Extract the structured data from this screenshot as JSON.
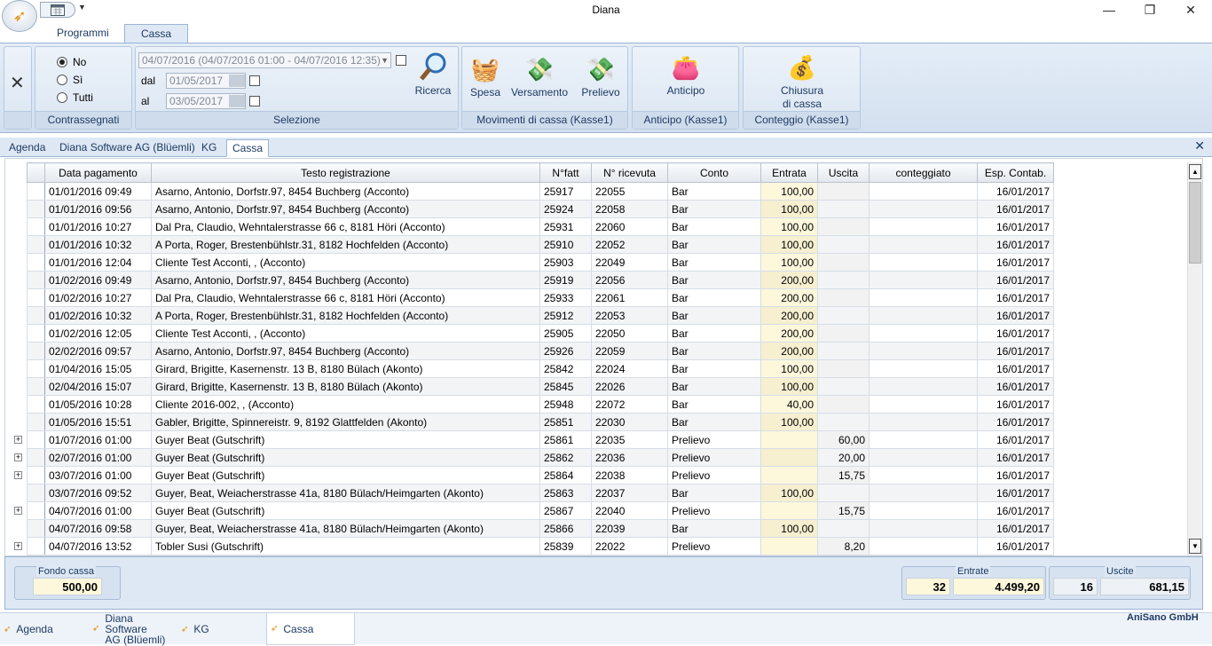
{
  "window": {
    "title": "Diana"
  },
  "ribbon_tabs": [
    "Programmi",
    "Cassa"
  ],
  "ribbon": {
    "contrassegnati": {
      "caption": "Contrassegnati",
      "options": [
        "No",
        "Sì",
        "Tutti"
      ],
      "selected": "No"
    },
    "selezione": {
      "caption": "Selezione",
      "period": "04/07/2016 (04/07/2016 01:00 - 04/07/2016 12:35)",
      "dal_label": "dal",
      "dal_value": "01/05/2017",
      "al_label": "al",
      "al_value": "03/05/2017",
      "search_label": "Ricerca"
    },
    "movimenti": {
      "caption": "Movimenti di cassa (Kasse1)",
      "spesa": "Spesa",
      "versamento": "Versamento",
      "prelievo": "Prelievo"
    },
    "anticipo": {
      "caption": "Anticipo (Kasse1)",
      "label": "Anticipo"
    },
    "conteggio": {
      "caption": "Conteggio (Kasse1)",
      "label1": "Chiusura",
      "label2": "di cassa"
    }
  },
  "doc_tabs": [
    "Agenda",
    "Diana Software AG (Blüemli)",
    "KG",
    "Cassa"
  ],
  "table": {
    "columns": [
      "Data pagamento",
      "Testo registrazione",
      "N°fatt",
      "N° ricevuta",
      "Conto",
      "Entrata",
      "Uscita",
      "conteggiato",
      "Esp. Contab."
    ],
    "rows": [
      {
        "d": "01/01/2016 09:49",
        "t": "Asarno, Antonio, Dorfstr.97, 8454 Buchberg (Acconto)",
        "f": "25917",
        "r": "22055",
        "c": "Bar",
        "e": "100,00",
        "u": "",
        "k": "",
        "x": "16/01/2017"
      },
      {
        "d": "01/01/2016 09:56",
        "t": "Asarno, Antonio, Dorfstr.97, 8454 Buchberg (Acconto)",
        "f": "25924",
        "r": "22058",
        "c": "Bar",
        "e": "100,00",
        "u": "",
        "k": "",
        "x": "16/01/2017"
      },
      {
        "d": "01/01/2016 10:27",
        "t": "Dal Pra, Claudio, Wehntalerstrasse 66 c, 8181 Höri (Acconto)",
        "f": "25931",
        "r": "22060",
        "c": "Bar",
        "e": "100,00",
        "u": "",
        "k": "",
        "x": "16/01/2017"
      },
      {
        "d": "01/01/2016 10:32",
        "t": "A Porta, Roger, Brestenbühlstr.31, 8182 Hochfelden (Acconto)",
        "f": "25910",
        "r": "22052",
        "c": "Bar",
        "e": "100,00",
        "u": "",
        "k": "",
        "x": "16/01/2017"
      },
      {
        "d": "01/01/2016 12:04",
        "t": "Cliente Test Acconti, ,  (Acconto)",
        "f": "25903",
        "r": "22049",
        "c": "Bar",
        "e": "100,00",
        "u": "",
        "k": "",
        "x": "16/01/2017"
      },
      {
        "d": "01/02/2016 09:49",
        "t": "Asarno, Antonio, Dorfstr.97, 8454 Buchberg (Acconto)",
        "f": "25919",
        "r": "22056",
        "c": "Bar",
        "e": "200,00",
        "u": "",
        "k": "",
        "x": "16/01/2017"
      },
      {
        "d": "01/02/2016 10:27",
        "t": "Dal Pra, Claudio, Wehntalerstrasse 66 c, 8181 Höri (Acconto)",
        "f": "25933",
        "r": "22061",
        "c": "Bar",
        "e": "200,00",
        "u": "",
        "k": "",
        "x": "16/01/2017"
      },
      {
        "d": "01/02/2016 10:32",
        "t": "A Porta, Roger, Brestenbühlstr.31, 8182 Hochfelden (Acconto)",
        "f": "25912",
        "r": "22053",
        "c": "Bar",
        "e": "200,00",
        "u": "",
        "k": "",
        "x": "16/01/2017"
      },
      {
        "d": "01/02/2016 12:05",
        "t": "Cliente Test Acconti, ,  (Acconto)",
        "f": "25905",
        "r": "22050",
        "c": "Bar",
        "e": "200,00",
        "u": "",
        "k": "",
        "x": "16/01/2017"
      },
      {
        "d": "02/02/2016 09:57",
        "t": "Asarno, Antonio, Dorfstr.97, 8454 Buchberg (Acconto)",
        "f": "25926",
        "r": "22059",
        "c": "Bar",
        "e": "200,00",
        "u": "",
        "k": "",
        "x": "16/01/2017"
      },
      {
        "d": "01/04/2016 15:05",
        "t": "Girard, Brigitte, Kasernenstr. 13 B, 8180 Bülach (Akonto)",
        "f": "25842",
        "r": "22024",
        "c": "Bar",
        "e": "100,00",
        "u": "",
        "k": "",
        "x": "16/01/2017"
      },
      {
        "d": "02/04/2016 15:07",
        "t": "Girard, Brigitte, Kasernenstr. 13 B, 8180 Bülach (Akonto)",
        "f": "25845",
        "r": "22026",
        "c": "Bar",
        "e": "100,00",
        "u": "",
        "k": "",
        "x": "16/01/2017"
      },
      {
        "d": "01/05/2016 10:28",
        "t": "Cliente 2016-002, ,  (Acconto)",
        "f": "25948",
        "r": "22072",
        "c": "Bar",
        "e": "40,00",
        "u": "",
        "k": "",
        "x": "16/01/2017"
      },
      {
        "d": "01/05/2016 15:51",
        "t": "Gabler, Brigitte, Spinnereistr. 9, 8192 Glattfelden (Akonto)",
        "f": "25851",
        "r": "22030",
        "c": "Bar",
        "e": "100,00",
        "u": "",
        "k": "",
        "x": "16/01/2017"
      },
      {
        "d": "01/07/2016 01:00",
        "t": "Guyer Beat (Gutschrift)",
        "f": "25861",
        "r": "22035",
        "c": "Prelievo",
        "e": "",
        "u": "60,00",
        "k": "",
        "x": "16/01/2017",
        "exp": true
      },
      {
        "d": "02/07/2016 01:00",
        "t": "Guyer Beat (Gutschrift)",
        "f": "25862",
        "r": "22036",
        "c": "Prelievo",
        "e": "",
        "u": "20,00",
        "k": "",
        "x": "16/01/2017",
        "exp": true
      },
      {
        "d": "03/07/2016 01:00",
        "t": "Guyer Beat (Gutschrift)",
        "f": "25864",
        "r": "22038",
        "c": "Prelievo",
        "e": "",
        "u": "15,75",
        "k": "",
        "x": "16/01/2017",
        "exp": true
      },
      {
        "d": "03/07/2016 09:52",
        "t": "Guyer, Beat, Weiacherstrasse 41a, 8180 Bülach/Heimgarten (Akonto)",
        "f": "25863",
        "r": "22037",
        "c": "Bar",
        "e": "100,00",
        "u": "",
        "k": "",
        "x": "16/01/2017"
      },
      {
        "d": "04/07/2016 01:00",
        "t": "Guyer Beat (Gutschrift)",
        "f": "25867",
        "r": "22040",
        "c": "Prelievo",
        "e": "",
        "u": "15,75",
        "k": "",
        "x": "16/01/2017",
        "exp": true
      },
      {
        "d": "04/07/2016 09:58",
        "t": "Guyer, Beat, Weiacherstrasse 41a, 8180 Bülach/Heimgarten (Akonto)",
        "f": "25866",
        "r": "22039",
        "c": "Bar",
        "e": "100,00",
        "u": "",
        "k": "",
        "x": "16/01/2017"
      },
      {
        "d": "04/07/2016 13:52",
        "t": "Tobler Susi (Gutschrift)",
        "f": "25839",
        "r": "22022",
        "c": "Prelievo",
        "e": "",
        "u": "8,20",
        "k": "",
        "x": "16/01/2017",
        "exp": true
      }
    ]
  },
  "footer": {
    "fondo_label": "Fondo cassa",
    "fondo_value": "500,00",
    "entrate_label": "Entrate",
    "entrate_count": "32",
    "entrate_total": "4.499,20",
    "uscite_label": "Uscite",
    "uscite_count": "16",
    "uscite_total": "681,15"
  },
  "company": "AniSano GmbH",
  "taskbar": [
    {
      "l1": "Agenda"
    },
    {
      "l1": "Diana Software",
      "l2": "AG (Blüemli)"
    },
    {
      "l1": "KG"
    },
    {
      "l1": "Cassa"
    }
  ]
}
